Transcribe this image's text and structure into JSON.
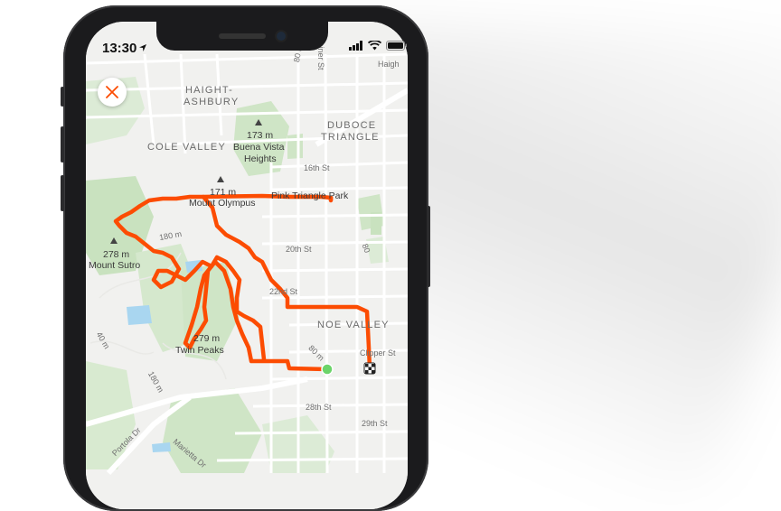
{
  "status_bar": {
    "time": "13:30"
  },
  "map": {
    "area_labels": [
      {
        "text": "HAIGHT-",
        "key": "haight1"
      },
      {
        "text": "ASHBURY",
        "key": "haight2"
      },
      {
        "text": "COLE VALLEY",
        "key": "cole"
      },
      {
        "text": "DUBOCE",
        "key": "duboce1"
      },
      {
        "text": "TRIANGLE",
        "key": "duboce2"
      },
      {
        "text": "NOE VALLEY",
        "key": "noe"
      }
    ],
    "peaks": [
      {
        "elevation": "173 m",
        "name": "Buena Vista",
        "name2": "Heights"
      },
      {
        "elevation": "171 m",
        "name": "Mount Olympus"
      },
      {
        "elevation": "278 m",
        "name": "Mount Sutro"
      },
      {
        "elevation": "279 m",
        "name": "Twin Peaks"
      }
    ],
    "places": [
      "Pink Triangle Park"
    ],
    "streets": [
      "Haigh",
      "Steiner St",
      "16th St",
      "20th St",
      "22nd St",
      "28th St",
      "29th St",
      "Clipper St",
      "Portola Dr",
      "Marietta Dr"
    ],
    "contours": [
      "80 m",
      "180 m",
      "80 m",
      "180 m",
      "40 m",
      "80"
    ]
  },
  "route": {
    "color": "#fc4c02",
    "start_color": "#6cd46a"
  }
}
